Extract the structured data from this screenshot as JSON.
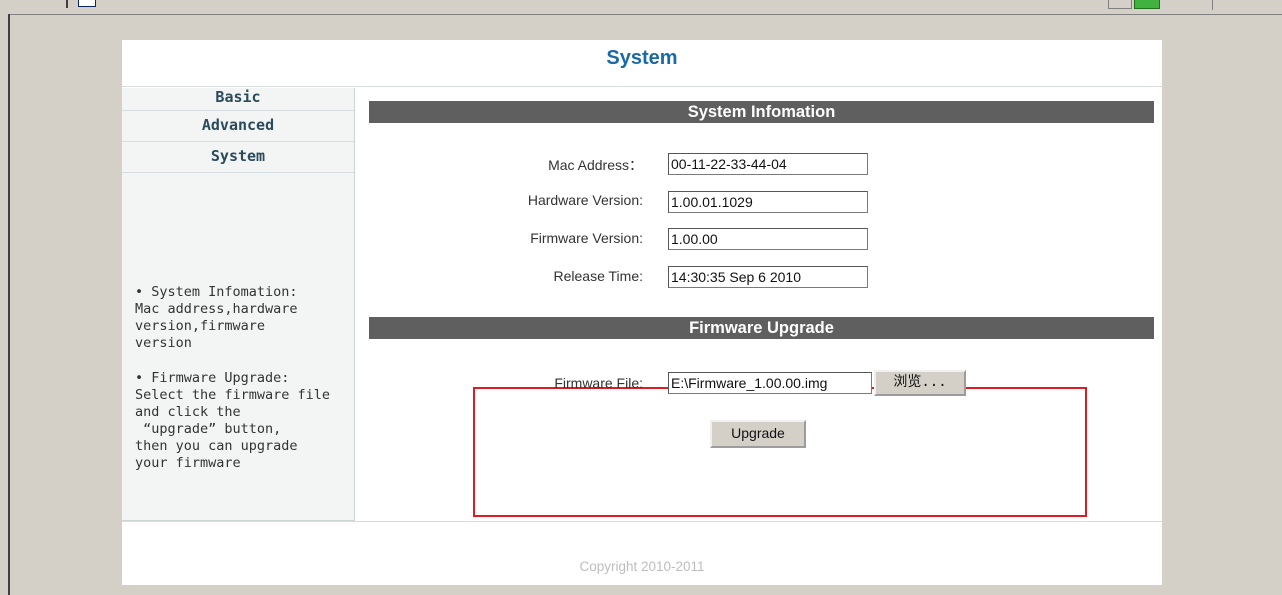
{
  "page_title": "System",
  "sidebar": {
    "items": [
      {
        "label": "Basic"
      },
      {
        "label": "Advanced"
      },
      {
        "label": "System"
      }
    ],
    "help": [
      "• System Infomation:\nMac address,hardware\nversion,firmware\nversion",
      "• Firmware Upgrade:\nSelect the firmware file\nand click the\n “upgrade” button,\nthen you can upgrade\nyour firmware"
    ]
  },
  "system_info": {
    "heading": "System Infomation",
    "mac_label": "Mac Address：",
    "mac_value": "00-11-22-33-44-04",
    "hw_label": "Hardware Version:",
    "hw_value": "1.00.01.1029",
    "fw_label": "Firmware Version:",
    "fw_value": "1.00.00",
    "release_label": "Release Time:",
    "release_value": "14:30:35 Sep  6 2010"
  },
  "firmware_upgrade": {
    "heading": "Firmware Upgrade",
    "file_label": "Firmware File:",
    "file_value": "E:\\Firmware_1.00.00.img",
    "browse_label": "浏览...",
    "upgrade_label": "Upgrade"
  },
  "footer": {
    "copyright": "Copyright 2010-2011"
  },
  "colors": {
    "title": "#1a6aa8",
    "section_bar": "#5f5f5f",
    "highlight_box": "#e01b24"
  }
}
